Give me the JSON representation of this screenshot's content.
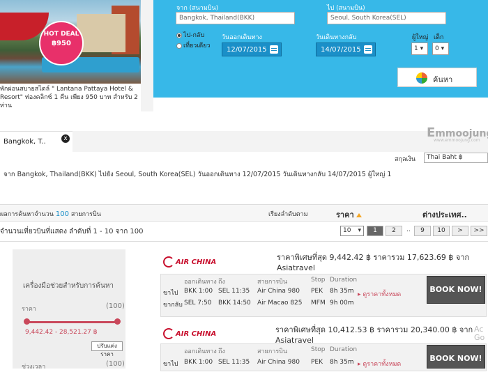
{
  "hotel": {
    "badge_title": "HOT DEAL",
    "badge_price": "฿950",
    "description": "พักผ่อนสบายสไตล์ \" Lantana Pattaya Hotel & Resort\" ท่องคลิกซ์ 1 คืน เพียง 950 บาท สำหรับ 2 ท่าน"
  },
  "search": {
    "from_label": "จาก (สนามบิน)",
    "from_value": "Bangkok, Thailand(BKK)",
    "to_label": "ไป (สนามบิน)",
    "to_value": "Seoul, South Korea(SEL)",
    "trip_roundtrip": "ไป-กลับ",
    "trip_oneway": "เที่ยวเดียว",
    "depart_label": "วันออกเดินทาง",
    "depart_value": "12/07/2015",
    "return_label": "วันเดินทางกลับ",
    "return_value": "14/07/2015",
    "adults_label": "ผู้ใหญ่",
    "adults_value": "1",
    "children_label": "เด็ก",
    "children_value": "0",
    "button_label": "ค้นหา"
  },
  "tab": {
    "label": "Bangkok, T..",
    "close": "x"
  },
  "brand": {
    "logo": "mmoojung",
    "sub": "www.emmoojung.com"
  },
  "currency": {
    "label": "สกุลเงิน",
    "value": "Thai Baht ฿"
  },
  "route_summary": "จาก Bangkok, Thailand(BKK) ไปยัง Seoul, South Korea(SEL) วันออกเดินทาง 12/07/2015   วันเดินทางกลับ 14/07/2015 ผู้ใหญ่ 1",
  "results": {
    "count_prefix": "ผลการค้นหาจำนวน",
    "count": "100",
    "count_suffix": "สายการบิน",
    "sort_label": "เรียงลำดับตาม",
    "sort_price": "ราคา",
    "sort_intl": "ต่างประเทศ..",
    "showing": "จำนวนเที่ยวบินที่แสดง ลำดับที่ 1 - 10 จาก 100",
    "per_page": "10",
    "pages": [
      "1",
      "2",
      "..",
      "9",
      "10",
      ">",
      ">>"
    ]
  },
  "filter": {
    "title": "เครื่องมือช่วยสำหรับการค้นหา",
    "price_label": "ราคา",
    "price_count": "(100)",
    "range": "9,442.42 - 28,521.27 ฿",
    "adjust": "ปรับแต่งราคา",
    "time_label": "ช่วงเวลา",
    "time_count": "(100)"
  },
  "flight_headers": {
    "depart": "ออกเดินทาง",
    "arrive": "ถึง",
    "airline": "สายการบิน",
    "stop": "Stop",
    "duration": "Duration"
  },
  "flights": [
    {
      "airline_logo": "AIR CHINA",
      "price_text": "ราคาพิเศษที่สุด 9,442.42 ฿ ราคารวม 17,623.69 ฿ จาก Asiatravel",
      "legs": [
        {
          "dir": "ขาไป",
          "dep": "BKK 1:00",
          "arr": "SEL 11:35",
          "airline": "Air China 980",
          "stop": "PEK",
          "dur": "8h 35m"
        },
        {
          "dir": "ขากลับ",
          "dep": "SEL 7:50",
          "arr": "BKK 14:50",
          "airline": "Air Macao 825",
          "stop": "MFM",
          "dur": "9h 00m"
        }
      ],
      "all_prices": "ดูราคาทั้งหมด",
      "book": "BOOK NOW!"
    },
    {
      "airline_logo": "AIR CHINA",
      "price_text": "ราคาพิเศษที่สุด 10,412.53 ฿ ราคารวม 20,340.00 ฿ จาก Asiatravel",
      "legs": [
        {
          "dir": "ขาไป",
          "dep": "BKK 1:00",
          "arr": "SEL 11:35",
          "airline": "Air China 980",
          "stop": "PEK",
          "dur": "8h 35m"
        }
      ],
      "all_prices": "ดูราคาทั้งหมด",
      "book": "BOOK NOW!"
    }
  ],
  "edge_text": "Ac Go",
  "colors": {
    "panel": "#37b8e8",
    "accent": "#c9485b",
    "link": "#1a8fc8"
  }
}
